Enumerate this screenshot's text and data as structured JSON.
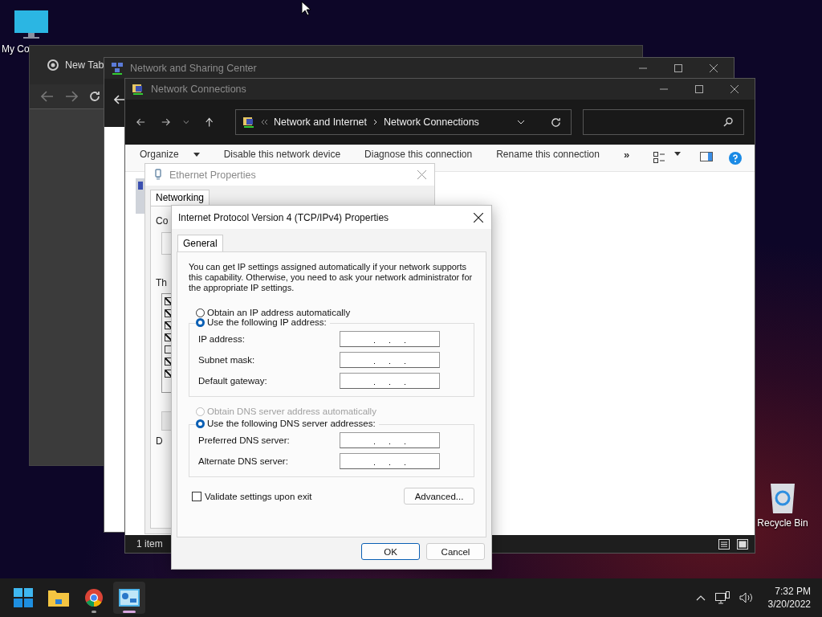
{
  "desktop_icons": [
    {
      "kind": "computer",
      "label": "My Co"
    },
    {
      "kind": "recycle",
      "label": "Recycle Bin"
    }
  ],
  "browser_window": {
    "tab": "New Tab"
  },
  "sharing_center_window": {
    "title": "Network and Sharing Center"
  },
  "connections_window": {
    "title": "Network Connections",
    "breadcrumb": [
      "Network and Internet",
      "Network Connections"
    ],
    "commands": [
      "Organize",
      "Disable this network device",
      "Diagnose this connection",
      "Rename this connection"
    ],
    "more": "»",
    "status": "1 item"
  },
  "ethernet_window": {
    "title": "Ethernet Properties",
    "tab": "Networking",
    "fragments": [
      "Co",
      "Th",
      "D"
    ],
    "components": [
      {
        "checked": true
      },
      {
        "checked": true
      },
      {
        "checked": true
      },
      {
        "checked": true
      },
      {
        "checked": false
      },
      {
        "checked": true
      },
      {
        "checked": true
      }
    ]
  },
  "ipv4_dialog": {
    "title": "Internet Protocol Version 4 (TCP/IPv4) Properties",
    "tab": "General",
    "description": "You can get IP settings assigned automatically if your network supports this capability. Otherwise, you need to ask your network administrator for the appropriate IP settings.",
    "ip_auto": {
      "label": "Obtain an IP address automatically",
      "selected": false,
      "disabled": false
    },
    "ip_manual": {
      "label": "Use the following IP address:",
      "selected": true,
      "disabled": false
    },
    "ip_fields": [
      {
        "label": "IP address:"
      },
      {
        "label": "Subnet mask:"
      },
      {
        "label": "Default gateway:"
      }
    ],
    "dns_auto": {
      "label": "Obtain DNS server address automatically",
      "selected": false,
      "disabled": true
    },
    "dns_manual": {
      "label": "Use the following DNS server addresses:",
      "selected": true,
      "disabled": false
    },
    "dns_fields": [
      {
        "label": "Preferred DNS server:"
      },
      {
        "label": "Alternate DNS server:"
      }
    ],
    "validate": {
      "label": "Validate settings upon exit",
      "checked": false
    },
    "advanced": "Advanced...",
    "ok": "OK",
    "cancel": "Cancel"
  },
  "taskbar": {
    "apps": [
      {
        "kind": "start",
        "running": false,
        "selected": false
      },
      {
        "kind": "folder",
        "running": false,
        "selected": false
      },
      {
        "kind": "chrome",
        "running": true,
        "selected": false
      },
      {
        "kind": "control",
        "running": true,
        "selected": true
      }
    ],
    "time": "7:32 PM",
    "date": "3/20/2022"
  }
}
